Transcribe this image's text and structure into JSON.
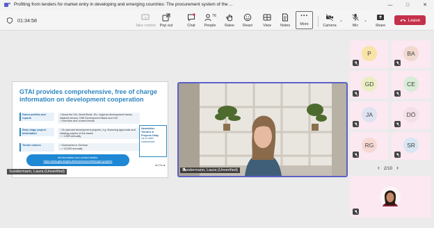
{
  "window": {
    "title": "Profiting from tenders for market entry in developing and emerging countries: The procurement system of the ...",
    "minimize": "—",
    "maximize": "□",
    "close": "✕"
  },
  "toolbar": {
    "timer": "01:34:58",
    "items": [
      {
        "label": "Take control",
        "icon": "take-control-icon",
        "disabled": true
      },
      {
        "label": "Pop out",
        "icon": "pop-out-icon"
      },
      {
        "label": "Chat",
        "icon": "chat-icon"
      },
      {
        "label": "People",
        "icon": "people-icon",
        "badge": "76"
      },
      {
        "label": "Raise",
        "icon": "raise-hand-icon"
      },
      {
        "label": "React",
        "icon": "react-icon"
      },
      {
        "label": "View",
        "icon": "view-icon"
      },
      {
        "label": "Notes",
        "icon": "notes-icon"
      },
      {
        "label": "More",
        "icon": "more-icon"
      },
      {
        "label": "Camera",
        "icon": "camera-off-icon"
      },
      {
        "label": "Mic",
        "icon": "mic-off-icon"
      },
      {
        "label": "Share",
        "icon": "share-icon"
      }
    ],
    "more_glyph": "···",
    "leave_label": "Leave",
    "leave_color": "#c4314b"
  },
  "slide": {
    "title": "GTAI provides comprehensive, free of charge information on development cooperation",
    "rows": [
      {
        "label": "Donor profiles and reports",
        "bullets": [
          "About the UN, World Bank, EU, regional development banks, bilateral donors, KfW Development Bank and GIZ",
          "Overview and current trends"
        ]
      },
      {
        "label": "Early stage project information",
        "bullets": [
          "On planned development projects, e.g. financing approvals and strategy papers of the banks",
          "> 3,500 annually"
        ]
      },
      {
        "label": "Tender notices",
        "bullets": [
          "Summaries in German",
          "> 15,000 annually"
        ]
      }
    ],
    "side_box": [
      "Newsletter",
      "Tenders &",
      "Projects Daily",
      "Up to date,",
      "customized"
    ],
    "contact_line1": "All information and contact details:",
    "contact_line2": "https://www.gtai.de/gtai-de/trade/ausschreibungen-projekte",
    "footer": "■ GTAI ■",
    "presenter_label": "Sundermann, Laura (Unverified)"
  },
  "camera": {
    "name": "Sundermann, Laura (Unverified)"
  },
  "gallery": {
    "participants": [
      {
        "initials": "P",
        "color": "#f7e4a6"
      },
      {
        "initials": "BA",
        "color": "#f1d9cf"
      },
      {
        "initials": "GD",
        "color": "#e9efc2"
      },
      {
        "initials": "CE",
        "color": "#d8ecd6"
      },
      {
        "initials": "JA",
        "color": "#dee2f1"
      },
      {
        "initials": "DÖ",
        "color": "#f3dfe6"
      },
      {
        "initials": "RG",
        "color": "#f7d9d4"
      },
      {
        "initials": "SR",
        "color": "#d7e6f2"
      }
    ],
    "pager": "2/10",
    "prev": "‹",
    "next": "›"
  }
}
